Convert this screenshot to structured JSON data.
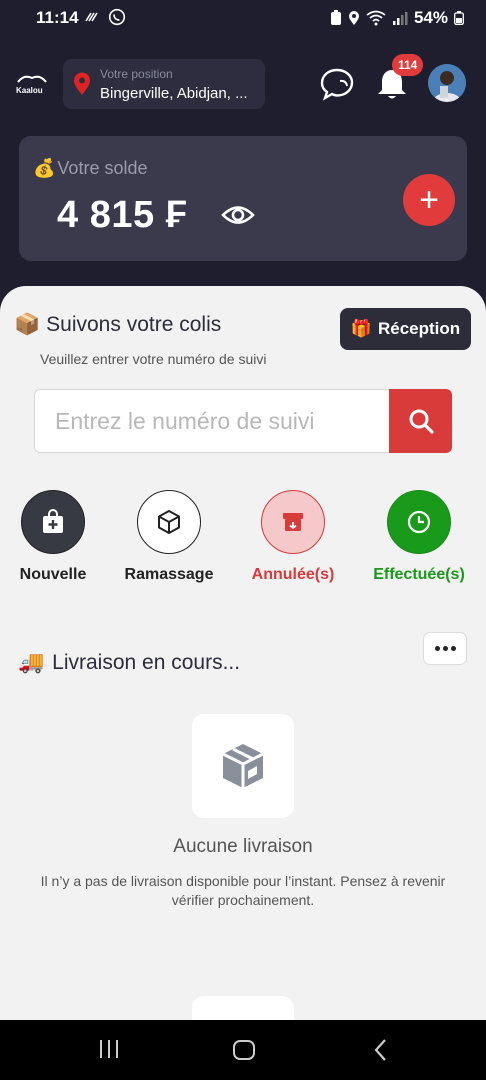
{
  "status_bar": {
    "time": "11:14",
    "battery": "54%"
  },
  "header": {
    "location_label": "Votre position",
    "location_value": "Bingerville, Abidjan, ...",
    "notification_count": "114",
    "logo_text": "Kaalou"
  },
  "balance": {
    "emoji": "💰",
    "label": "Votre solde",
    "amount": "4 815 ₣",
    "add_symbol": "+"
  },
  "tracking": {
    "emoji": "📦",
    "title": "Suivons votre colis",
    "subtitle": "Veuillez entrer votre numéro de suivi",
    "placeholder": "Entrez le numéro de suivi",
    "reception_emoji": "🎁",
    "reception_label": "Réception"
  },
  "categories": [
    {
      "label": "Nouvelle",
      "icon": "bag-plus-icon",
      "color": "#222222"
    },
    {
      "label": "Ramassage",
      "icon": "box-icon",
      "color": "#222222"
    },
    {
      "label": "Annulée(s)",
      "icon": "archive-icon",
      "color": "#d93a3a"
    },
    {
      "label": "Effectuée(s)",
      "icon": "clock-icon",
      "color": "#1a9a1a"
    }
  ],
  "deliveries": {
    "emoji": "🚚",
    "title": "Livraison en cours...",
    "empty_title": "Aucune livraison",
    "empty_desc": "Il n’y a pas de livraison disponible pour l’instant. Pensez à revenir vérifier prochainement."
  },
  "colors": {
    "accent": "#d93a3a",
    "dark": "#1e1e2e",
    "success": "#1a9a1a"
  }
}
